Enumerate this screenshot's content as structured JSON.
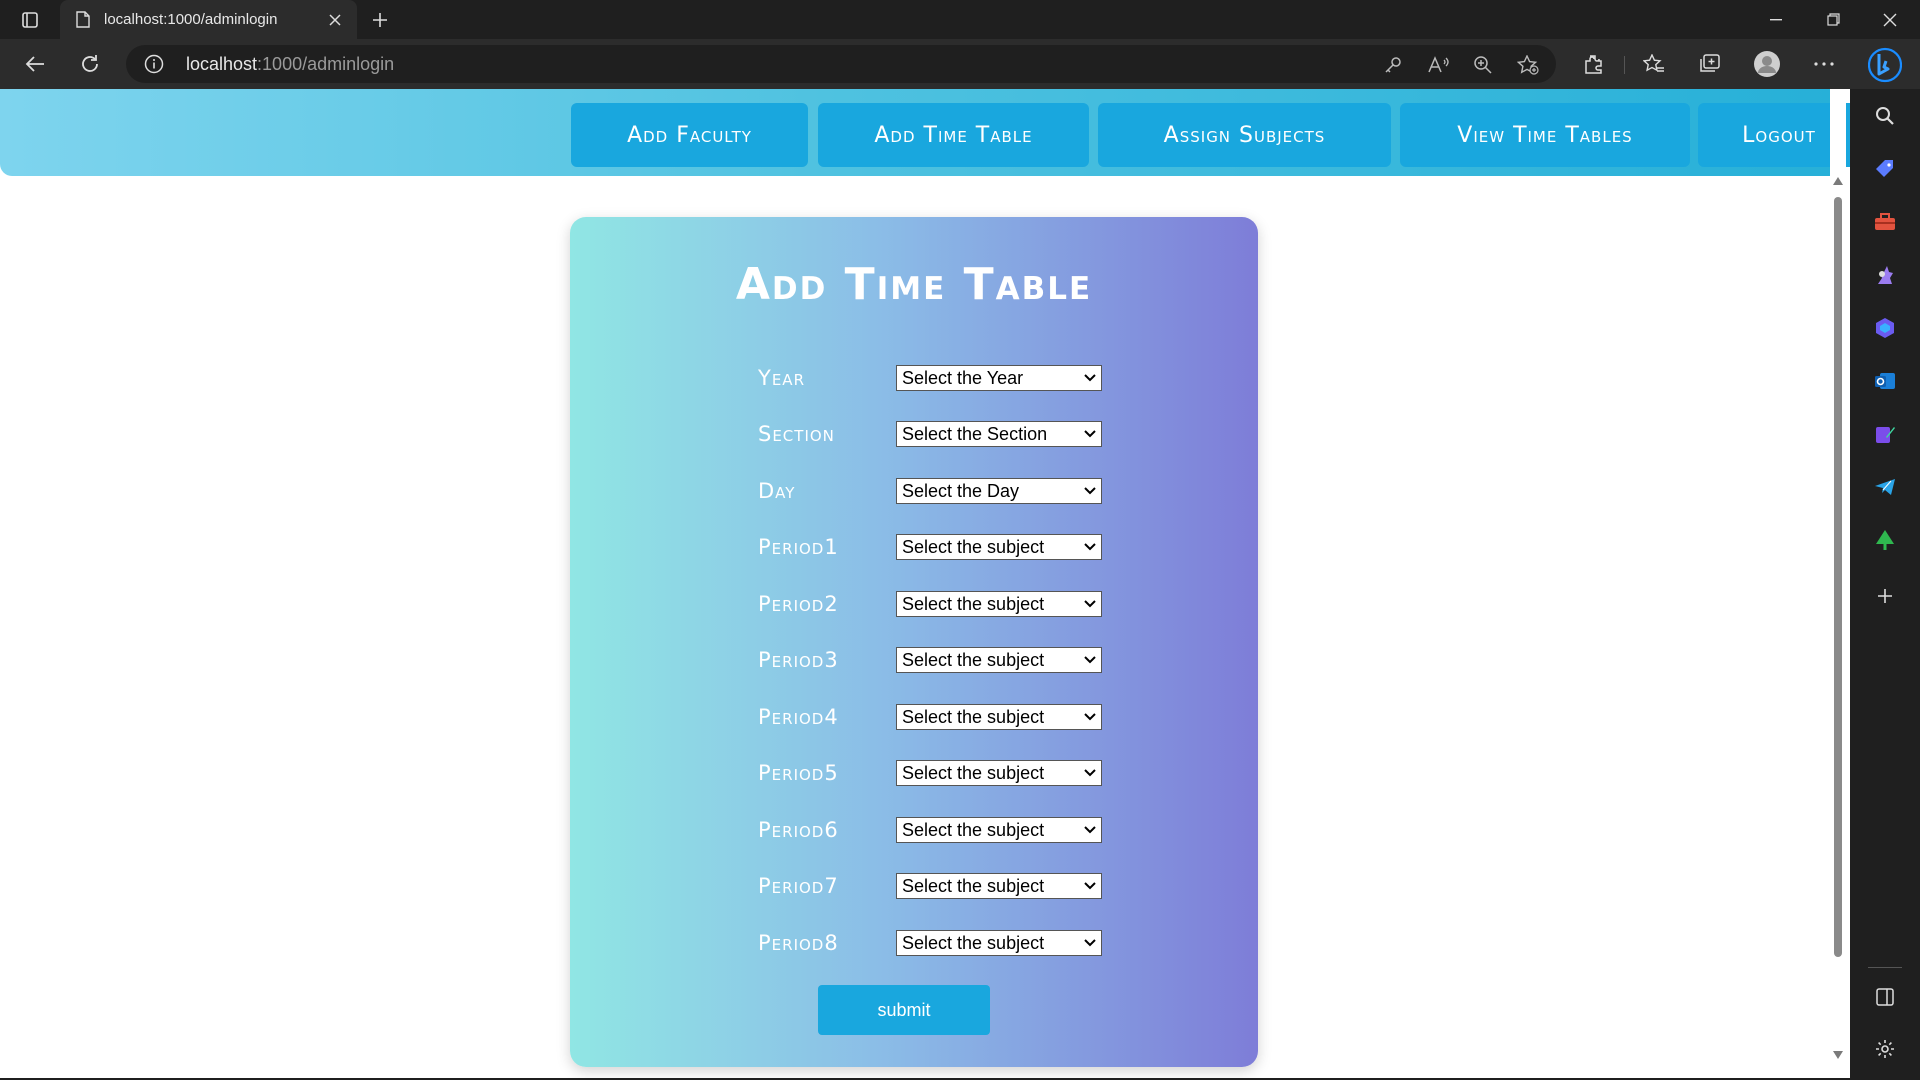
{
  "browser": {
    "tab": {
      "title": "localhost:1000/adminlogin"
    },
    "address_bar": {
      "host": "localhost",
      "path": ":1000/adminlogin"
    }
  },
  "site_nav": {
    "links": [
      {
        "label": "Add Faculty"
      },
      {
        "label": "Add Time Table"
      },
      {
        "label": "Assign Subjects"
      },
      {
        "label": "View Time Tables"
      },
      {
        "label": "Logout"
      }
    ]
  },
  "form": {
    "title": "Add Time Table",
    "rows": [
      {
        "label": "Year",
        "select": "Select the Year"
      },
      {
        "label": "Section",
        "select": "Select the Section"
      },
      {
        "label": "Day",
        "select": "Select the Day"
      },
      {
        "label": "Period1",
        "select": "Select the subject"
      },
      {
        "label": "Period2",
        "select": "Select the subject"
      },
      {
        "label": "Period3",
        "select": "Select the subject"
      },
      {
        "label": "Period4",
        "select": "Select the subject"
      },
      {
        "label": "Period5",
        "select": "Select the subject"
      },
      {
        "label": "Period6",
        "select": "Select the subject"
      },
      {
        "label": "Period7",
        "select": "Select the subject"
      },
      {
        "label": "Period8",
        "select": "Select the subject"
      }
    ],
    "submit_label": "submit"
  },
  "colors": {
    "nav_button": "#19a7de",
    "card_gradient_start": "#90e6e4",
    "card_gradient_end": "#7e7dd8",
    "browser_dark": "#1f1f1f"
  },
  "icons": {
    "browser": [
      "tab-actions-icon",
      "page-icon",
      "close-icon",
      "plus-icon",
      "minimize-icon",
      "restore-icon",
      "close-window-icon",
      "back-arrow-icon",
      "refresh-icon",
      "info-icon",
      "key-icon",
      "read-aloud-icon",
      "zoom-icon",
      "favorite-add-icon",
      "extensions-icon",
      "favorites-icon",
      "collections-icon",
      "profile-avatar-icon",
      "more-icon",
      "copilot-icon"
    ],
    "sidebar": [
      "search-icon",
      "shopping-tag-icon",
      "toolbox-icon",
      "games-icon",
      "microsoft-365-icon",
      "outlook-icon",
      "designer-icon",
      "telegram-icon",
      "tree-icon",
      "add-icon",
      "sidebar-panel-icon",
      "settings-icon"
    ]
  }
}
